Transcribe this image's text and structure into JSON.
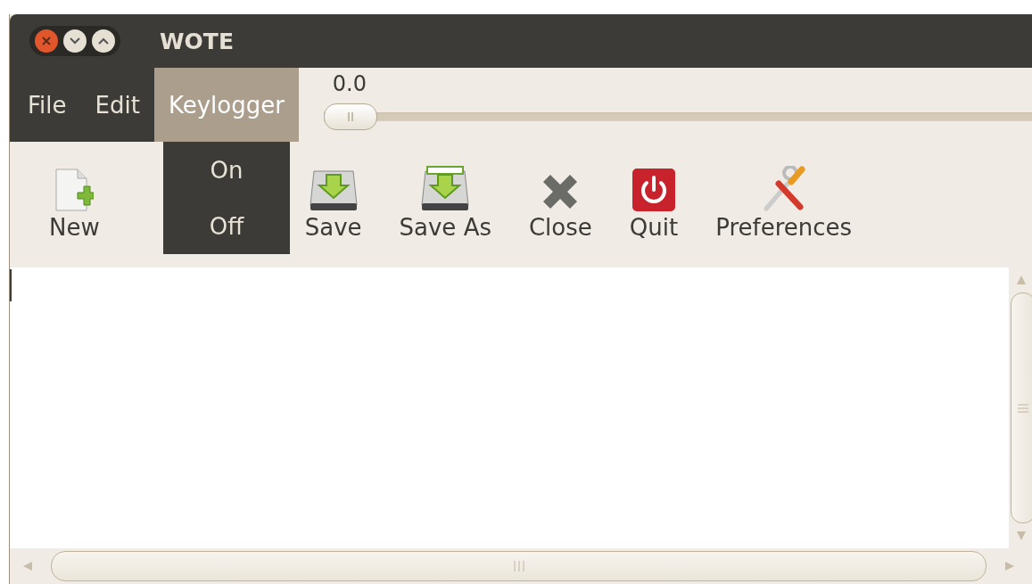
{
  "window": {
    "title": "WOTE"
  },
  "menu_bar": [
    {
      "label": "File",
      "selected": false
    },
    {
      "label": "Edit",
      "selected": false
    },
    {
      "label": "Keylogger",
      "selected": true
    }
  ],
  "open_menu": {
    "items": [
      {
        "label": "On"
      },
      {
        "label": "Off"
      }
    ]
  },
  "slider": {
    "reading": "0.0",
    "level": 0
  },
  "toolbar": [
    {
      "kind": "new",
      "label": "New"
    },
    {
      "kind": "save",
      "label": "Save"
    },
    {
      "kind": "save_as",
      "label": "Save As"
    },
    {
      "kind": "close",
      "label": "Close"
    },
    {
      "kind": "quit",
      "label": "Quit"
    },
    {
      "kind": "preferences",
      "label": "Preferences"
    }
  ]
}
